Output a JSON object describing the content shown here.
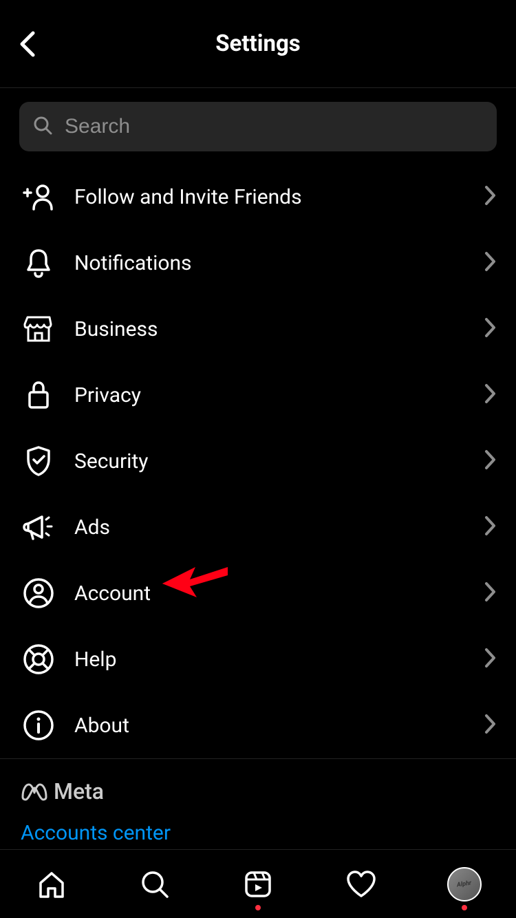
{
  "header": {
    "title": "Settings"
  },
  "search": {
    "placeholder": "Search"
  },
  "menu": {
    "items": [
      {
        "label": "Follow and Invite Friends",
        "icon": "person-add-icon"
      },
      {
        "label": "Notifications",
        "icon": "bell-icon"
      },
      {
        "label": "Business",
        "icon": "storefront-icon"
      },
      {
        "label": "Privacy",
        "icon": "lock-icon"
      },
      {
        "label": "Security",
        "icon": "shield-check-icon"
      },
      {
        "label": "Ads",
        "icon": "megaphone-icon"
      },
      {
        "label": "Account",
        "icon": "user-circle-icon"
      },
      {
        "label": "Help",
        "icon": "lifebuoy-icon"
      },
      {
        "label": "About",
        "icon": "info-circle-icon"
      }
    ]
  },
  "footer": {
    "brand": "Meta",
    "link": "Accounts center"
  },
  "annotation": {
    "arrow_points_to_item_index": 6
  }
}
